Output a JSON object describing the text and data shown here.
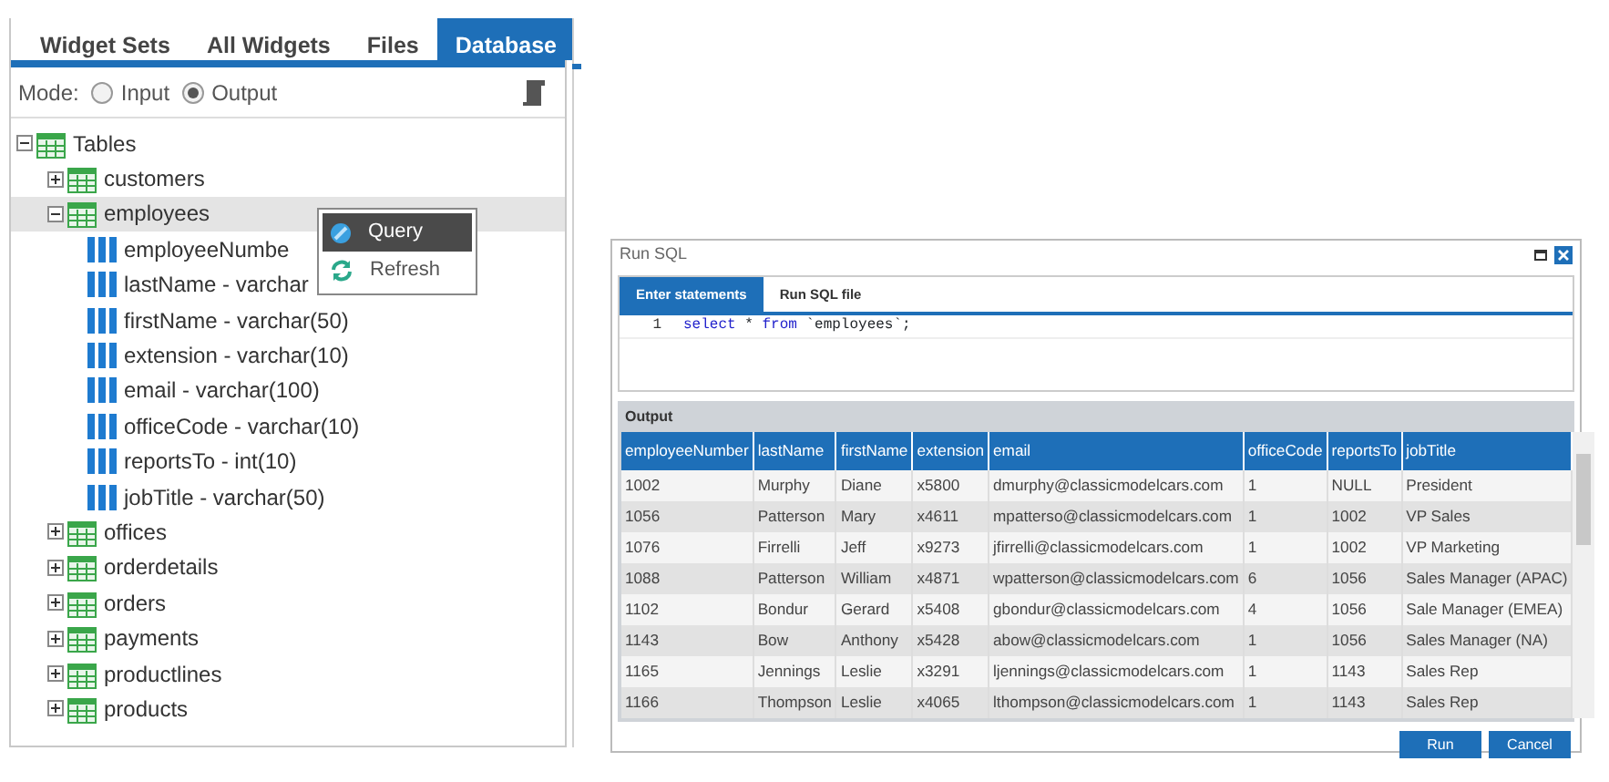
{
  "panel_tabs": [
    {
      "label": "Widget Sets",
      "selected": false
    },
    {
      "label": "All Widgets",
      "selected": false
    },
    {
      "label": "Files",
      "selected": false
    },
    {
      "label": "Database",
      "selected": true
    }
  ],
  "mode": {
    "label": "Mode:",
    "options": [
      {
        "label": "Input",
        "checked": false
      },
      {
        "label": "Output",
        "checked": true
      }
    ]
  },
  "tree": [
    {
      "label": "Tables",
      "kind": "folder",
      "expanded": true,
      "selected": false,
      "children": [
        {
          "label": "customers",
          "kind": "table",
          "expanded": false,
          "selected": false
        },
        {
          "label": "employees",
          "kind": "table",
          "expanded": true,
          "selected": true,
          "children": [
            {
              "label": "employeeNumbe",
              "kind": "column",
              "selected": false
            },
            {
              "label": "lastName - varchar",
              "kind": "column",
              "selected": false
            },
            {
              "label": "firstName - varchar(50)",
              "kind": "column",
              "selected": false
            },
            {
              "label": "extension - varchar(10)",
              "kind": "column",
              "selected": false
            },
            {
              "label": "email - varchar(100)",
              "kind": "column",
              "selected": false
            },
            {
              "label": "officeCode - varchar(10)",
              "kind": "column",
              "selected": false
            },
            {
              "label": "reportsTo - int(10)",
              "kind": "column",
              "selected": false
            },
            {
              "label": "jobTitle - varchar(50)",
              "kind": "column",
              "selected": false
            }
          ]
        },
        {
          "label": "offices",
          "kind": "table",
          "expanded": false,
          "selected": false
        },
        {
          "label": "orderdetails",
          "kind": "table",
          "expanded": false,
          "selected": false
        },
        {
          "label": "orders",
          "kind": "table",
          "expanded": false,
          "selected": false
        },
        {
          "label": "payments",
          "kind": "table",
          "expanded": false,
          "selected": false
        },
        {
          "label": "productlines",
          "kind": "table",
          "expanded": false,
          "selected": false
        },
        {
          "label": "products",
          "kind": "table",
          "expanded": false,
          "selected": false
        }
      ]
    }
  ],
  "context_menu": [
    {
      "label": "Query",
      "kind": "query",
      "selected": true
    },
    {
      "label": "Refresh",
      "kind": "refresh",
      "selected": false
    }
  ],
  "dialog": {
    "title": "Run SQL",
    "tabs": [
      {
        "label": "Enter statements",
        "selected": true
      },
      {
        "label": "Run SQL file",
        "selected": false
      }
    ],
    "editor": {
      "line_number": "1",
      "code": [
        {
          "text": "select",
          "kind": "keyword"
        },
        {
          "text": " * ",
          "kind": "plain"
        },
        {
          "text": "from",
          "kind": "keyword"
        },
        {
          "text": " `employees`;",
          "kind": "plain"
        }
      ]
    },
    "output_label": "Output",
    "table": {
      "columns": [
        "employeeNumber",
        "lastName",
        "firstName",
        "extension",
        "email",
        "officeCode",
        "reportsTo",
        "jobTitle"
      ],
      "rows": [
        [
          "1002",
          "Murphy",
          "Diane",
          "x5800",
          "dmurphy@classicmodelcars.com",
          "1",
          "NULL",
          "President"
        ],
        [
          "1056",
          "Patterson",
          "Mary",
          "x4611",
          "mpatterso@classicmodelcars.com",
          "1",
          "1002",
          "VP Sales"
        ],
        [
          "1076",
          "Firrelli",
          "Jeff",
          "x9273",
          "jfirrelli@classicmodelcars.com",
          "1",
          "1002",
          "VP Marketing"
        ],
        [
          "1088",
          "Patterson",
          "William",
          "x4871",
          "wpatterson@classicmodelcars.com",
          "6",
          "1056",
          "Sales Manager (APAC)"
        ],
        [
          "1102",
          "Bondur",
          "Gerard",
          "x5408",
          "gbondur@classicmodelcars.com",
          "4",
          "1056",
          "Sale Manager (EMEA)"
        ],
        [
          "1143",
          "Bow",
          "Anthony",
          "x5428",
          "abow@classicmodelcars.com",
          "1",
          "1056",
          "Sales Manager (NA)"
        ],
        [
          "1165",
          "Jennings",
          "Leslie",
          "x3291",
          "ljennings@classicmodelcars.com",
          "1",
          "1143",
          "Sales Rep"
        ],
        [
          "1166",
          "Thompson",
          "Leslie",
          "x4065",
          "lthompson@classicmodelcars.com",
          "1",
          "1143",
          "Sales Rep"
        ]
      ]
    },
    "buttons": [
      "Run",
      "Cancel"
    ]
  }
}
